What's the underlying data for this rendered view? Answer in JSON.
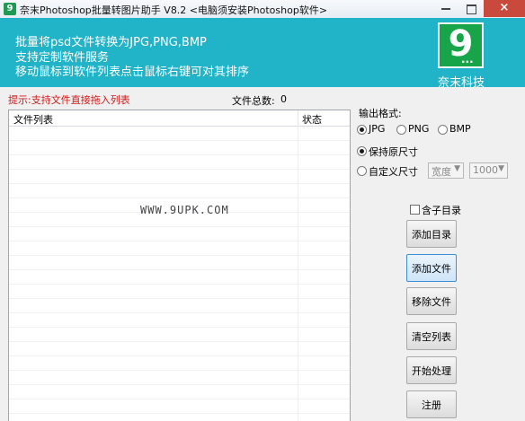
{
  "window": {
    "title": "奈末Photoshop批量转图片助手 V8.2 <电脑须安装Photoshop软件>",
    "controls": {
      "minimize": "minimize",
      "maximize": "maximize",
      "close": "×"
    }
  },
  "banner": {
    "lines": [
      "批量将psd文件转换为JPG,PNG,BMP",
      "支持定制软件服务",
      "移动鼠标到软件列表点击鼠标右键可对其排序"
    ],
    "logo_text": "9",
    "logo_dots": "...",
    "brand": "奈末科技",
    "colors": {
      "banner": "#21b3c8",
      "logo": "#18a54a"
    }
  },
  "hint": "提示:支持文件直接拖入列表",
  "file_count": {
    "label": "文件总数:",
    "value": "0"
  },
  "file_list": {
    "columns": [
      "文件列表",
      "状态"
    ],
    "rows": [],
    "watermark": "WWW.9UPK.COM"
  },
  "output": {
    "format_label": "输出格式:",
    "formats": [
      {
        "label": "JPG",
        "selected": true
      },
      {
        "label": "PNG",
        "selected": false
      },
      {
        "label": "BMP",
        "selected": false
      }
    ],
    "size_options": [
      {
        "label": "保持原尺寸",
        "selected": true
      },
      {
        "label": "自定义尺寸",
        "selected": false
      }
    ],
    "width_select": "宽度",
    "height_select": "1000",
    "include_subdirs": {
      "label": "含子目录",
      "checked": false
    }
  },
  "buttons": {
    "add_dir": "添加目录",
    "add_file": "添加文件",
    "remove_file": "移除文件",
    "clear_list": "清空列表",
    "start": "开始处理",
    "register": "注册"
  }
}
